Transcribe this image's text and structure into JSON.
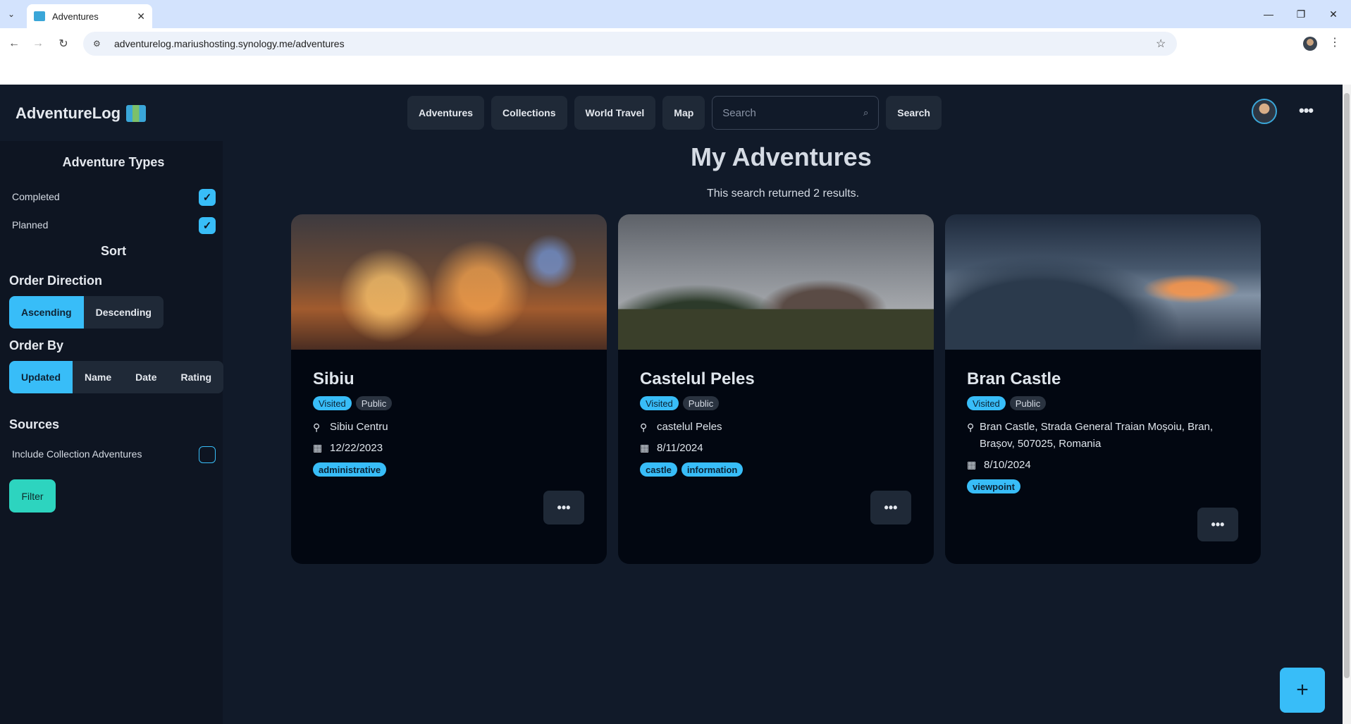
{
  "browser": {
    "tab_title": "Adventures",
    "url": "adventurelog.mariushosting.synology.me/adventures"
  },
  "app": {
    "brand": "AdventureLog",
    "nav": [
      "Adventures",
      "Collections",
      "World Travel",
      "Map"
    ],
    "search_placeholder": "Search",
    "search_button": "Search"
  },
  "sidebar": {
    "types_title": "Adventure Types",
    "completed_label": "Completed",
    "completed_checked": true,
    "planned_label": "Planned",
    "planned_checked": true,
    "sort_title": "Sort",
    "order_direction_label": "Order Direction",
    "direction_options": [
      "Ascending",
      "Descending"
    ],
    "direction_selected": "Ascending",
    "order_by_label": "Order By",
    "order_by_options": [
      "Updated",
      "Name",
      "Date",
      "Rating"
    ],
    "order_by_selected": "Updated",
    "sources_label": "Sources",
    "include_collections_label": "Include Collection Adventures",
    "include_collections_checked": false,
    "filter_button": "Filter"
  },
  "main": {
    "title": "My Adventures",
    "results_text": "This search returned 2 results."
  },
  "cards": [
    {
      "name": "Sibiu",
      "status": "Visited",
      "visibility": "Public",
      "location": "Sibiu Centru",
      "date": "12/22/2023",
      "tags": [
        "administrative"
      ]
    },
    {
      "name": "Castelul Peles",
      "status": "Visited",
      "visibility": "Public",
      "location": "castelul Peles",
      "date": "8/11/2024",
      "tags": [
        "castle",
        "information"
      ]
    },
    {
      "name": "Bran Castle",
      "status": "Visited",
      "visibility": "Public",
      "location": "Bran Castle, Strada General Traian Moșoiu, Bran, Brașov, 507025, Romania",
      "date": "8/10/2024",
      "tags": [
        "viewpoint"
      ]
    }
  ],
  "fab_label": "+",
  "icons": {
    "more": "•••",
    "pin": "pin-icon",
    "calendar": "calendar-icon"
  }
}
